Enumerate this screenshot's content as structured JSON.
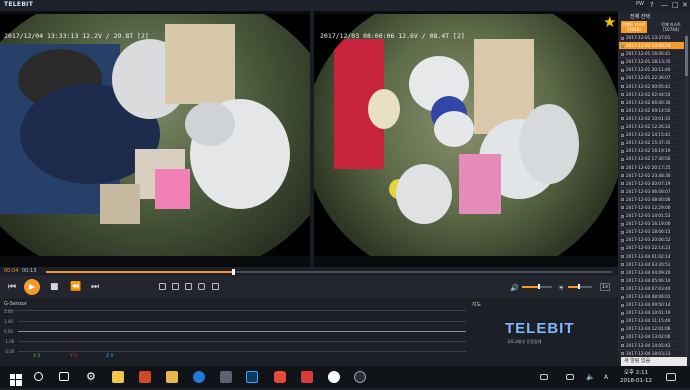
{
  "app": {
    "title": "TELEBIT",
    "pw_label": "PW",
    "window_controls": [
      "?",
      "—",
      "□",
      "✕"
    ]
  },
  "cameras": [
    {
      "osd": "2017/12/04 13:33:13 12.2V / 29.8T [2]"
    },
    {
      "osd": "2017/12/03 08:00:06 12.6V / 08.4T [2]"
    }
  ],
  "timeline": {
    "current": "00:04",
    "total": "00:13",
    "progress": 0.33
  },
  "controls": {
    "buttons": [
      "prev-icon",
      "play-icon",
      "stop-icon",
      "rewind-icon",
      "next-icon",
      "folder-icon",
      "save-icon",
      "snapshot-icon",
      "camera-icon",
      "screen-icon"
    ],
    "volume": 0.55,
    "volume2": 0.45,
    "speed_label": "1x"
  },
  "gsensor": {
    "label": "G-Sensor",
    "ticks": [
      "2.00",
      "1.00",
      "0.00",
      "-1.00",
      "-2.00"
    ],
    "axes": [
      {
        "label": "X 0",
        "color": "#2fcc45"
      },
      {
        "label": "Y 0",
        "color": "#e03c3c"
      },
      {
        "label": "Z 0",
        "color": "#3fa7ff"
      }
    ]
  },
  "map": {
    "label": "지도"
  },
  "brand": {
    "logo": "TELEBIT",
    "sub": "국토교통부 인증업체"
  },
  "sidepanel": {
    "tab": "전체 선택",
    "event_list_label": "이벤트 리스트",
    "event_list_count": "[4918]",
    "all_list_label": "전체 리스트",
    "all_list_count": "[10744]",
    "files": [
      "2017-12-01 13:37:01",
      "2017-12-01 13:28:54",
      "2017-12-01 16:06:41",
      "2017-12-01 18:13:35",
      "2017-12-01 20:11:40",
      "2017-12-01 22:36:07",
      "2017-12-02 00:05:41",
      "2017-12-02 02:44:54",
      "2017-12-02 06:00:30",
      "2017-12-02 09:14:50",
      "2017-12-02 10:01:31",
      "2017-12-02 12:26:22",
      "2017-12-02 14:15:41",
      "2017-12-02 15:37:35",
      "2017-12-02 16:19:19",
      "2017-12-02 17:30:56",
      "2017-12-02 20:17:25",
      "2017-12-02 23:48:30",
      "2017-12-03 00:07:19",
      "2017-12-03 06:08:07",
      "2017-12-03 08:00:06",
      "2017-12-03 12:29:00",
      "2017-12-03 14:01:53",
      "2017-12-03 16:19:00",
      "2017-12-03 18:06:15",
      "2017-12-03 20:06:52",
      "2017-12-03 22:14:23",
      "2017-12-04 01:02:14",
      "2017-12-04 03:20:51",
      "2017-12-04 04:09:20",
      "2017-12-04 05:06:10",
      "2017-12-04 07:03:44",
      "2017-12-04 08:06:01",
      "2017-12-04 09:50:14",
      "2017-12-04 10:01:19",
      "2017-12-04 11:15:40",
      "2017-12-04 12:01:06",
      "2017-12-04 13:02:00",
      "2017-12-04 14:05:43",
      "2017-12-04 18:03:23",
      "2017-12-04 21:36:47",
      "2017-12-04 23:04:16",
      "2017-12-05 00:04:51",
      "2017-12-05 01:06:32",
      "2017-12-05 03:08:01",
      "2017-12-05 04:07:41"
    ],
    "active_index": 1,
    "toast": "새 알림 없음"
  },
  "taskbar": {
    "icons": [
      "windows-start-icon",
      "search-icon",
      "task-view-icon",
      "settings-icon",
      "file-explorer-icon",
      "powerpoint-icon",
      "folder-icon",
      "edge-icon",
      "store-icon",
      "photoshop-icon",
      "app-icon",
      "camera-app-icon",
      "record-app-icon",
      "telebit-viewer-icon"
    ],
    "time": "오후 2:11",
    "date": "2018-01-12"
  }
}
